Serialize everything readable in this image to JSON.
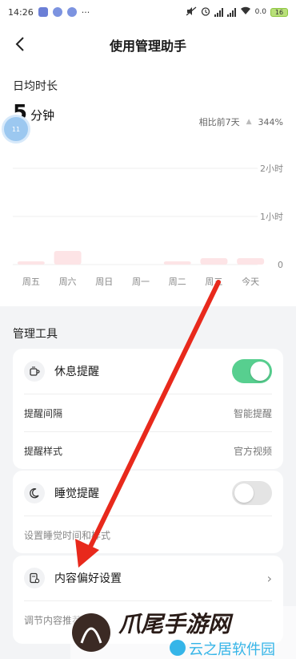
{
  "status_bar": {
    "time": "14:26",
    "more": "···",
    "network_speed": "0.0",
    "battery": "16"
  },
  "header": {
    "title": "使用管理助手"
  },
  "usage": {
    "section_label": "日均时长",
    "value": "5",
    "unit": "分钟",
    "compare_label": "相比前7天",
    "compare_value": "344%",
    "badge": "11"
  },
  "chart_data": {
    "type": "bar",
    "categories": [
      "周五",
      "周六",
      "周日",
      "周一",
      "周二",
      "周三",
      "今天"
    ],
    "values": [
      4,
      17,
      0,
      0,
      4,
      8,
      8
    ],
    "unit": "分钟",
    "y_tick_values": [
      0,
      60,
      120
    ],
    "y_tick_labels": [
      "0",
      "1小时",
      "2小时"
    ],
    "ylim": [
      0,
      125
    ],
    "colors": [
      "#fde4e6",
      "#fde4e6",
      "#fde4e6",
      "#fde4e6",
      "#fde4e6",
      "#fde4e6",
      "#fde4e6"
    ]
  },
  "tools": {
    "section_label": "管理工具",
    "rest_reminder": {
      "title": "休息提醒",
      "enabled": true,
      "interval_label": "提醒间隔",
      "interval_value": "智能提醒",
      "style_label": "提醒样式",
      "style_value": "官方视频"
    },
    "sleep_reminder": {
      "title": "睡觉提醒",
      "enabled": false,
      "description": "设置睡觉时间和样式"
    },
    "content_preference": {
      "title": "内容偏好设置",
      "description": "调节内容推荐"
    }
  },
  "watermark": {
    "text_1": "爪尾手游网",
    "text_2": "云之居软件园"
  },
  "colors": {
    "accent_green": "#57cf8f",
    "bar_pink": "#fde4e6",
    "arrow_red": "#e8291c"
  }
}
